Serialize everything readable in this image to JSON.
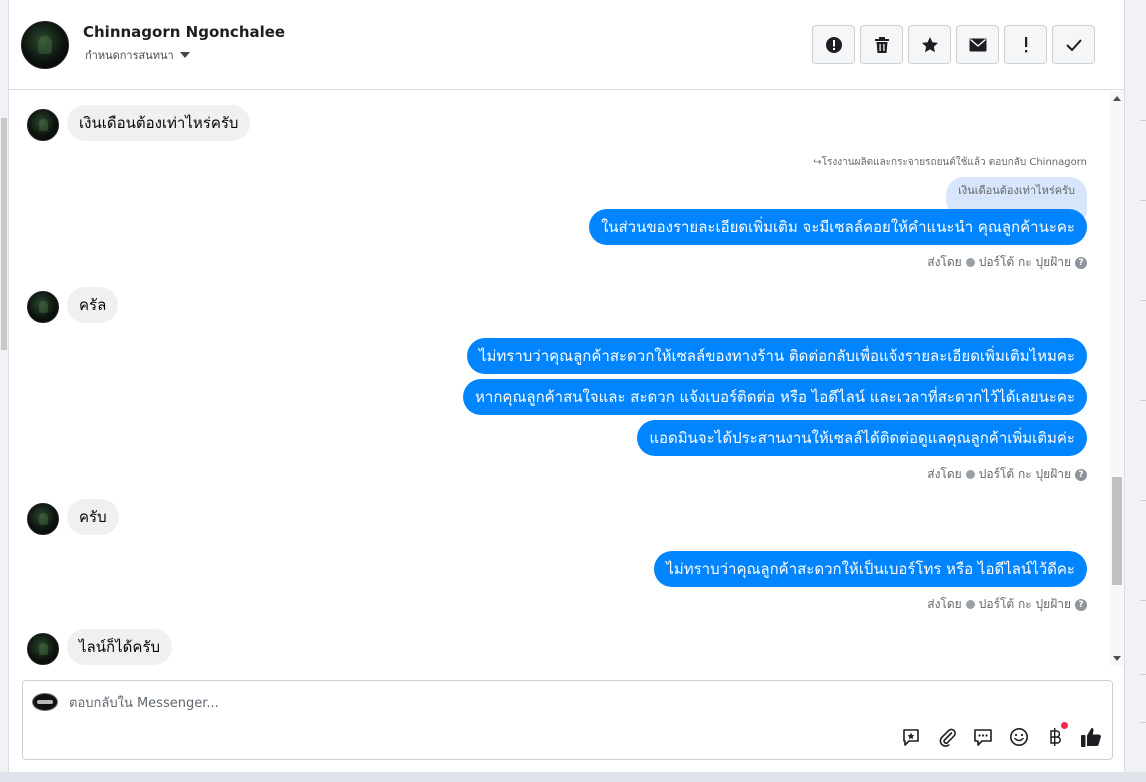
{
  "header": {
    "contact_name": "Chinnagorn Ngonchalee",
    "subtitle": "กำหนดการสนทนา"
  },
  "toolbar": {
    "buttons": [
      {
        "icon": "alert-circle-icon"
      },
      {
        "icon": "trash-icon"
      },
      {
        "icon": "star-icon"
      },
      {
        "icon": "envelope-icon"
      },
      {
        "icon": "exclamation-icon"
      },
      {
        "icon": "checkmark-icon"
      }
    ]
  },
  "thread": {
    "messages": [
      {
        "direction": "incoming",
        "text": "เงินเดือนต้องเท่าไหร่ครับ"
      },
      {
        "direction": "outgoing",
        "reply_meta": "โรงงานผลิตและกระจายรถยนต์ใช้แล้ว ตอบกลับ Chinnagorn",
        "quoted_text": "เงินเดือนต้องเท่าไหร่ครับ",
        "text": "ในส่วนของรายละเอียดเพิ่มเติม จะมีเซลล์คอยให้คำแนะนำ คุณลูกค้านะคะ",
        "sent_by_label": "ส่งโดย",
        "sender": "ปอร์โต้ กะ ปุยฝ้าย"
      },
      {
        "direction": "incoming",
        "text": "ครัล"
      },
      {
        "direction": "outgoing",
        "text": "ไม่ทราบว่าคุณลูกค้าสะดวกให้เซลล์ของทางร้าน ติดต่อกลับเพื่อแจ้งรายละเอียดเพิ่มเติมไหมคะ"
      },
      {
        "direction": "outgoing",
        "text": "หากคุณลูกค้าสนใจและ สะดวก แจ้งเบอร์ติดต่อ หรือ ไอดีไลน์ และเวลาที่สะดวกไว้ได้เลยนะคะ"
      },
      {
        "direction": "outgoing",
        "text": "แอดมินจะได้ประสานงานให้เซลล์ได้ติดต่อดูแลคุณลูกค้าเพิ่มเติมค่ะ",
        "sent_by_label": "ส่งโดย",
        "sender": "ปอร์โต้ กะ ปุยฝ้าย"
      },
      {
        "direction": "incoming",
        "text": "ครับ"
      },
      {
        "direction": "outgoing",
        "text": "ไม่ทราบว่าคุณลูกค้าสะดวกให้เป็นเบอร์โทร หรือ ไอดีไลน์ไว้ดีคะ",
        "sent_by_label": "ส่งโดย",
        "sender": "ปอร์โต้ กะ ปุยฝ้าย"
      },
      {
        "direction": "incoming",
        "text": "ไลน์ก็ได้ครับ"
      }
    ]
  },
  "composer": {
    "placeholder": "ตอบกลับใน Messenger...",
    "icons": [
      "saved-reply-icon",
      "attachment-icon",
      "chat-bubble-icon",
      "emoji-icon",
      "baht-payment-icon",
      "like-icon"
    ]
  },
  "colors": {
    "outgoing_bubble": "#0084ff",
    "incoming_bubble": "#f0f0f0",
    "quoted_bubble": "#d8e6fb",
    "notification_dot": "#f02849"
  }
}
